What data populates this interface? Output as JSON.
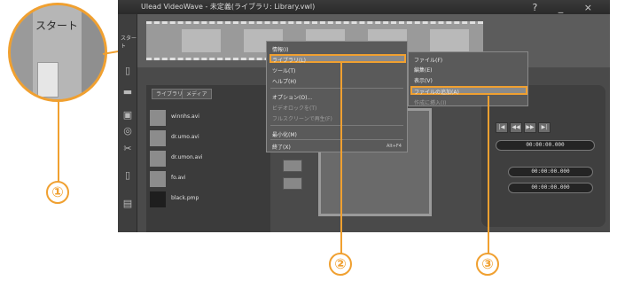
{
  "app": {
    "window_title": "Ulead VideoWave - 未定義(ライブラリ: Library.vwl)",
    "window_controls": "? _ ×",
    "start_tab": "スタート"
  },
  "library": {
    "tabs": [
      "ライブラリ",
      "メディア"
    ],
    "items": [
      "winnhs.avi",
      "dr.umo.avi",
      "dr.umon.avi",
      "fo.avi",
      "black.pmp"
    ]
  },
  "context_menu": {
    "items": [
      {
        "label": "情報(I)",
        "accel": "",
        "enabled": true
      },
      {
        "label": "ライブラリ(L)",
        "accel": "",
        "enabled": true,
        "selected": true
      },
      {
        "label": "ツール(T)",
        "accel": "",
        "enabled": true
      },
      {
        "label": "ヘルプ(H)",
        "accel": "",
        "enabled": true
      },
      {
        "label": "オプション(O)...",
        "accel": "",
        "enabled": true
      },
      {
        "label": "ビデオロックを(T)",
        "accel": "",
        "enabled": false
      },
      {
        "label": "フルスクリーンで再生(F)",
        "accel": "",
        "enabled": false
      },
      {
        "label": "最小化(M)",
        "accel": "",
        "enabled": true
      },
      {
        "label": "終了(X)",
        "accel": "Alt+F4",
        "enabled": true
      }
    ]
  },
  "submenu": {
    "items": [
      {
        "label": "ファイル(F)",
        "enabled": true
      },
      {
        "label": "編集(E)",
        "enabled": true
      },
      {
        "label": "表示(V)",
        "enabled": true
      },
      {
        "label": "ファイルの追加(A)",
        "enabled": true,
        "selected": true
      },
      {
        "label": "作成に挿入(I)",
        "enabled": false
      }
    ]
  },
  "timecodes": [
    "00:00:00.000",
    "00:00:00.000",
    "00:00:00.000"
  ],
  "transport_buttons": [
    "|◀",
    "◀◀",
    "▶▶",
    "▶|"
  ],
  "zoom": {
    "label": "スタート"
  },
  "callouts": [
    "①",
    "②",
    "③"
  ],
  "colors": {
    "accent": "#f0a030"
  }
}
